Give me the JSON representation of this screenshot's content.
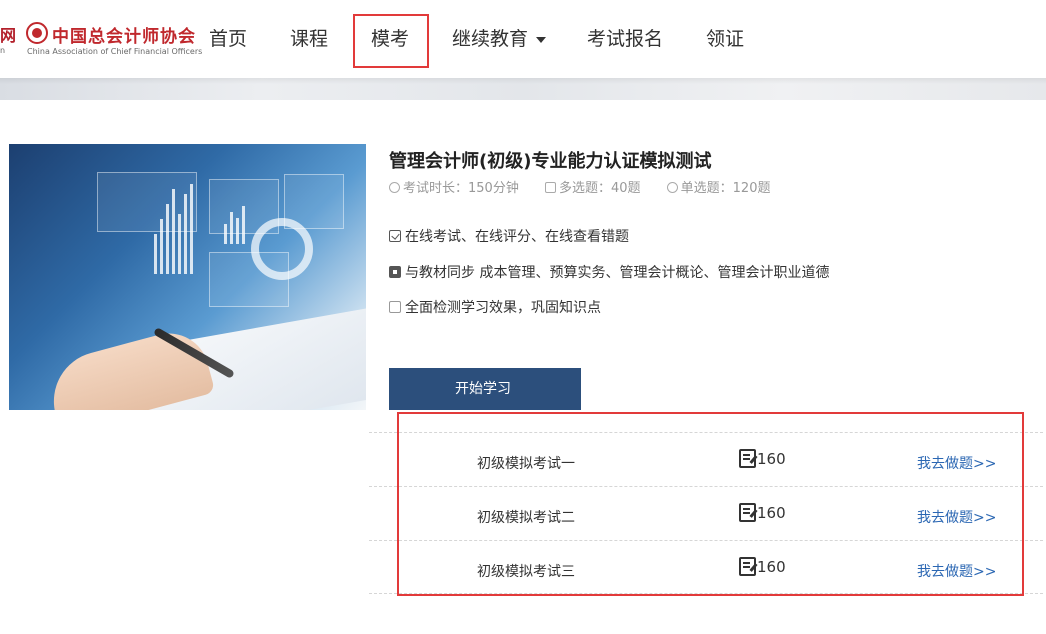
{
  "header": {
    "logo_cut_text": "网",
    "logo_cut_sub": "n",
    "logo_title": "中国总会计师协会",
    "logo_subtitle": "China Association of Chief Financial Officers",
    "nav": [
      {
        "label": "首页"
      },
      {
        "label": "课程"
      },
      {
        "label": "模考",
        "active": true
      },
      {
        "label": "继续教育",
        "dropdown": true
      },
      {
        "label": "考试报名"
      },
      {
        "label": "领证"
      }
    ]
  },
  "hero": {
    "icon": "finance-chart-image"
  },
  "course": {
    "title": "管理会计师(初级)专业能力认证模拟测试",
    "meta": {
      "duration": "考试时长：150分钟",
      "multi": "多选题：40题",
      "single": "单选题：120题"
    },
    "features": [
      "在线考试、在线评分、在线查看错题",
      "与教材同步 成本管理、预算实务、管理会计概论、管理会计职业道德",
      "全面检测学习效果，巩固知识点"
    ],
    "start_button": "开始学习"
  },
  "exams": [
    {
      "name": "初级模拟考试一",
      "count": "160",
      "action": "我去做题>>"
    },
    {
      "name": "初级模拟考试二",
      "count": "160",
      "action": "我去做题>>"
    },
    {
      "name": "初级模拟考试三",
      "count": "160",
      "action": "我去做题>>"
    }
  ],
  "colors": {
    "accent": "#2c4f7c",
    "link": "#2b67b3",
    "highlight_box": "#e23a3a",
    "brand_red": "#c0282d"
  }
}
